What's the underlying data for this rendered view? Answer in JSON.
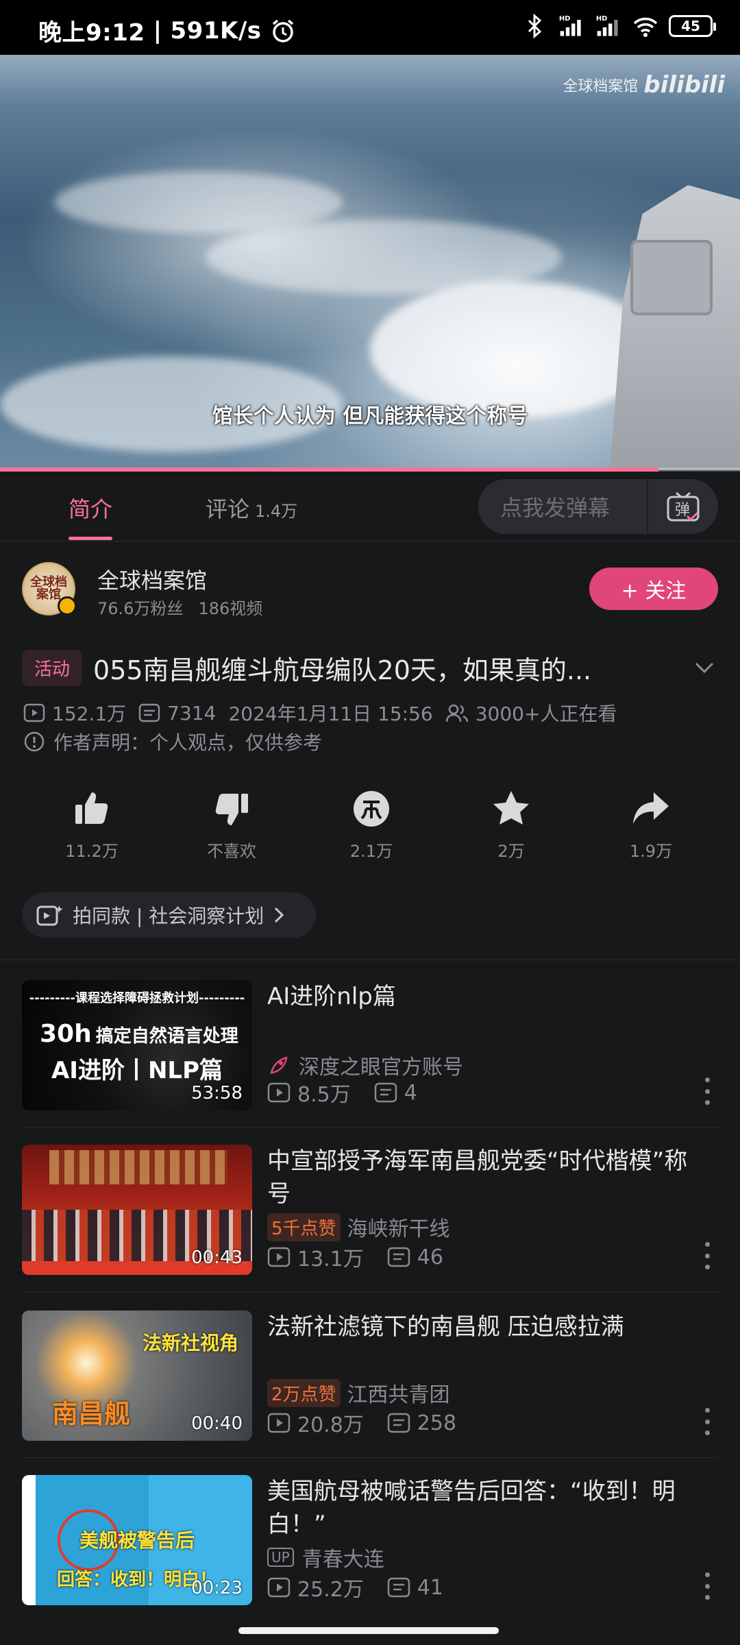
{
  "status_bar": {
    "time": "晚上9:12",
    "speed": "591K/s",
    "battery": "45",
    "network_label": "HD"
  },
  "video": {
    "watermark_channel": "全球档案馆",
    "watermark_logo": "bilibili",
    "subtitle": "馆长个人认为 但凡能获得这个称号",
    "progress": 0.89
  },
  "tabs": {
    "intro": "简介",
    "comments": "评论",
    "comments_count": "1.4万",
    "danmu_placeholder": "点我发弹幕",
    "danmu_button": "弹"
  },
  "uploader": {
    "name": "全球档案馆",
    "fans": "76.6万粉丝",
    "videos": "186视频",
    "follow_label": "+ 关注",
    "avatar_text": "全球档案馆"
  },
  "video_info": {
    "activity_tag": "活动",
    "title": "055南昌舰缠斗航母编队20天，如果真的...",
    "plays": "152.1万",
    "danmaku": "7314",
    "date": "2024年1月11日 15:56",
    "watching": "3000+人正在看",
    "notice": "作者声明：个人观点，仅供参考"
  },
  "actions": [
    {
      "icon": "thumbs-up-icon",
      "label": "11.2万"
    },
    {
      "icon": "thumbs-down-icon",
      "label": "不喜欢"
    },
    {
      "icon": "coin-icon",
      "label": "2.1万"
    },
    {
      "icon": "star-icon",
      "label": "2万"
    },
    {
      "icon": "share-icon",
      "label": "1.9万"
    }
  ],
  "activity_chip": "拍同款 | 社会洞察计划",
  "recommendations": [
    {
      "title": "AI进阶nlp篇",
      "author": "深度之眼官方账号",
      "plays": "8.5万",
      "danmaku": "4",
      "duration": "53:58",
      "thumb_line1": "---------课程选择障碍拯救计划---------",
      "thumb_line2a": "30h",
      "thumb_line2b": "搞定自然语言处理",
      "thumb_line3": "AI进阶丨NLP篇"
    },
    {
      "title": "中宣部授予海军南昌舰党委“时代楷模”称号",
      "badge": "5千点赞",
      "author": "海峡新干线",
      "plays": "13.1万",
      "danmaku": "46",
      "duration": "00:43"
    },
    {
      "title": "法新社滤镜下的南昌舰  压迫感拉满",
      "badge": "2万点赞",
      "author": "江西共青团",
      "plays": "20.8万",
      "danmaku": "258",
      "duration": "00:40",
      "thumb_line1": "法新社视角",
      "thumb_line2": "南昌舰"
    },
    {
      "title": "美国航母被喊话警告后回答：“收到！明白！”",
      "badge_up": "UP",
      "author": "青春大连",
      "plays": "25.2万",
      "danmaku": "41",
      "duration": "00:23",
      "thumb_line1": "美舰被警告后",
      "thumb_line2": "回答：收到！明白！"
    }
  ],
  "colors": {
    "accent": "#fb7299",
    "follow_bg": "#e0467c",
    "background": "#17181a"
  }
}
